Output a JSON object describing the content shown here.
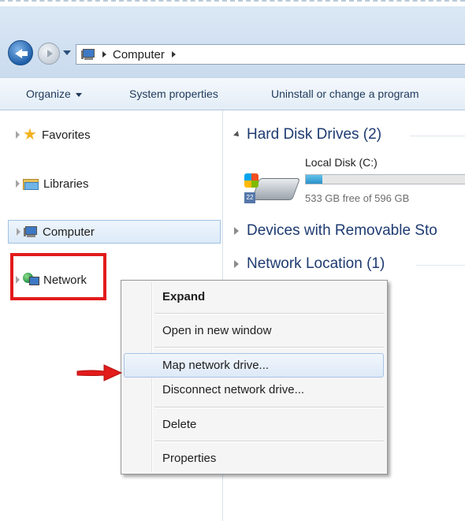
{
  "address_bar": {
    "crumbs": [
      "Computer"
    ]
  },
  "toolbar": {
    "organize_label": "Organize",
    "system_properties_label": "System properties",
    "uninstall_label": "Uninstall or change a program"
  },
  "nav_pane": {
    "items": [
      {
        "label": "Favorites",
        "icon": "star-icon"
      },
      {
        "label": "Libraries",
        "icon": "libraries-folder-icon"
      },
      {
        "label": "Computer",
        "icon": "computer-icon"
      },
      {
        "label": "Network",
        "icon": "network-icon"
      }
    ],
    "selected": "Computer",
    "highlighted": "Network"
  },
  "content": {
    "groups": [
      {
        "label": "Hard Disk Drives (2)",
        "expanded": true
      },
      {
        "label": "Devices with Removable Sto",
        "expanded": false
      },
      {
        "label": "Network Location (1)",
        "expanded": false
      }
    ],
    "drive": {
      "name": "Local Disk (C:)",
      "free_text": "533 GB free of 596 GB",
      "used_fraction": 0.106,
      "bar_color": "#2a91c9"
    }
  },
  "context_menu": {
    "items": [
      {
        "label": "Expand",
        "bold": true
      },
      {
        "label": "Open in new window"
      },
      {
        "label": "Map network drive...",
        "hovered": true
      },
      {
        "label": "Disconnect network drive..."
      },
      {
        "label": "Delete"
      },
      {
        "label": "Properties"
      }
    ]
  },
  "annotations": {
    "highlight_color": "#e21b1b",
    "arrow_color": "#e21b1b"
  }
}
